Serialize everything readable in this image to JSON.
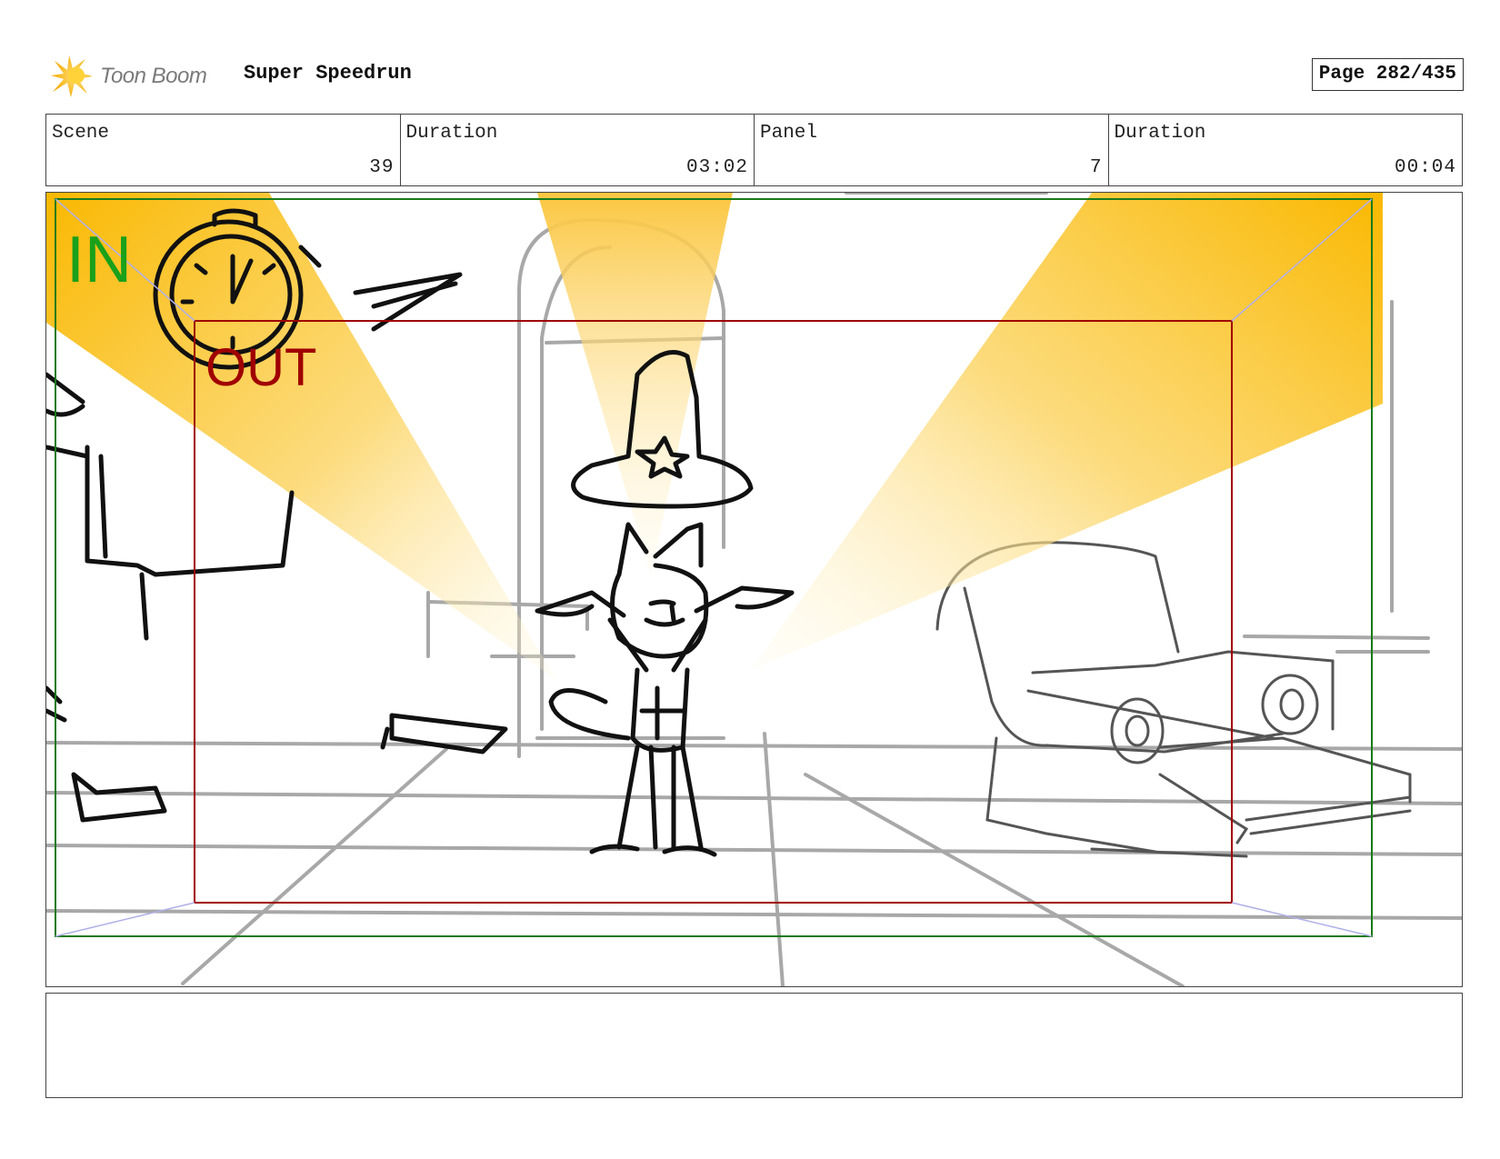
{
  "header": {
    "logo_text": "Toon Boom",
    "project_title": "Super Speedrun",
    "page_label": "Page 282/435"
  },
  "info": {
    "scene_label": "Scene",
    "scene_value": "39",
    "scene_duration_label": "Duration",
    "scene_duration_value": "03:02",
    "panel_label": "Panel",
    "panel_value": "7",
    "panel_duration_label": "Duration",
    "panel_duration_value": "00:04"
  },
  "panel_image": {
    "in_label": "IN",
    "out_label": "OUT",
    "in_color": "#1aa01a",
    "out_color": "#a00000",
    "spotlight_color": "#f9b800"
  },
  "notes": {
    "text": ""
  }
}
